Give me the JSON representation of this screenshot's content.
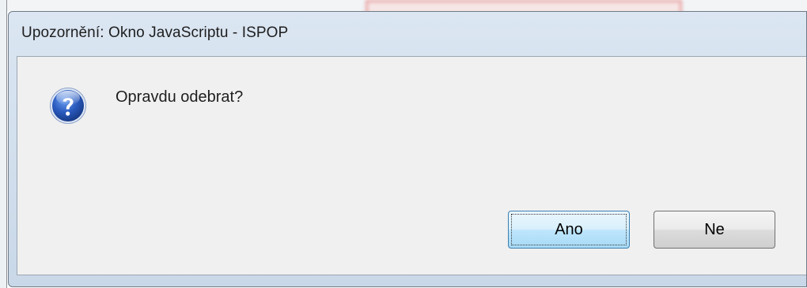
{
  "dialog": {
    "title": "Upozornění: Okno JavaScriptu - ISPOP",
    "message": "Opravdu odebrat?",
    "icon": "question-icon",
    "buttons": {
      "yes_label": "Ano",
      "no_label": "Ne"
    }
  },
  "colors": {
    "icon_blue": "#2a5bbf",
    "focus_button": "#3c7fb1"
  }
}
